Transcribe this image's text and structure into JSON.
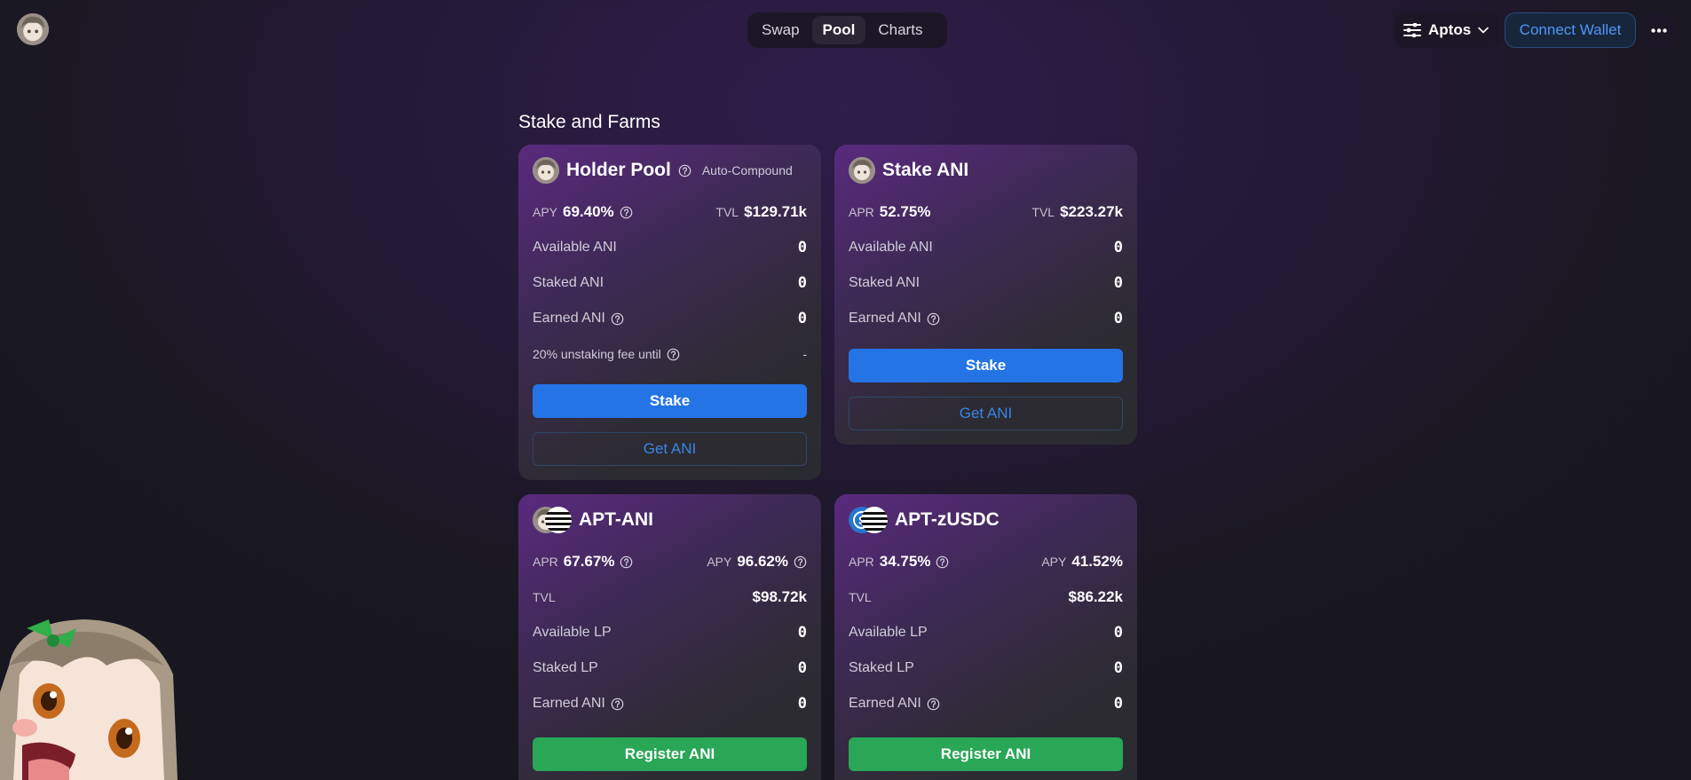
{
  "nav": {
    "tabs": [
      {
        "label": "Swap",
        "active": false
      },
      {
        "label": "Pool",
        "active": true
      },
      {
        "label": "Charts",
        "active": false
      }
    ]
  },
  "header": {
    "network_label": "Aptos",
    "connect_label": "Connect Wallet",
    "network_icon": "sliders-icon",
    "more_icon": "more-dots-icon"
  },
  "page": {
    "title": "Stake and Farms"
  },
  "cards": {
    "holder": {
      "title": "Holder Pool",
      "badge": "Auto-Compound",
      "rate_label": "APY",
      "rate_value": "69.40%",
      "tvl_label": "TVL",
      "tvl_value": "$129.71k",
      "rows": [
        {
          "label": "Available ANI",
          "value": "0"
        },
        {
          "label": "Staked ANI",
          "value": "0"
        },
        {
          "label": "Earned ANI",
          "value": "0"
        }
      ],
      "fee_label": "20% unstaking fee until",
      "fee_value": "-",
      "primary": "Stake",
      "secondary": "Get ANI"
    },
    "stake": {
      "title": "Stake ANI",
      "rate_label": "APR",
      "rate_value": "52.75%",
      "tvl_label": "TVL",
      "tvl_value": "$223.27k",
      "rows": [
        {
          "label": "Available ANI",
          "value": "0"
        },
        {
          "label": "Staked ANI",
          "value": "0"
        },
        {
          "label": "Earned ANI",
          "value": "0"
        }
      ],
      "primary": "Stake",
      "secondary": "Get ANI"
    },
    "apt_ani": {
      "title": "APT-ANI",
      "apr_label": "APR",
      "apr_value": "67.67%",
      "apy_label": "APY",
      "apy_value": "96.62%",
      "tvl_label": "TVL",
      "tvl_value": "$98.72k",
      "rows": [
        {
          "label": "Available LP",
          "value": "0"
        },
        {
          "label": "Staked LP",
          "value": "0"
        },
        {
          "label": "Earned ANI",
          "value": "0"
        }
      ],
      "primary": "Register ANI"
    },
    "apt_zusdc": {
      "title": "APT-zUSDC",
      "apr_label": "APR",
      "apr_value": "34.75%",
      "apy_label": "APY",
      "apy_value": "41.52%",
      "tvl_label": "TVL",
      "tvl_value": "$86.22k",
      "rows": [
        {
          "label": "Available LP",
          "value": "0"
        },
        {
          "label": "Staked LP",
          "value": "0"
        },
        {
          "label": "Earned ANI",
          "value": "0"
        }
      ],
      "primary": "Register ANI"
    }
  },
  "colors": {
    "primary_button": "#2574e6",
    "green_button": "#29a656",
    "link": "#3a84e6"
  }
}
